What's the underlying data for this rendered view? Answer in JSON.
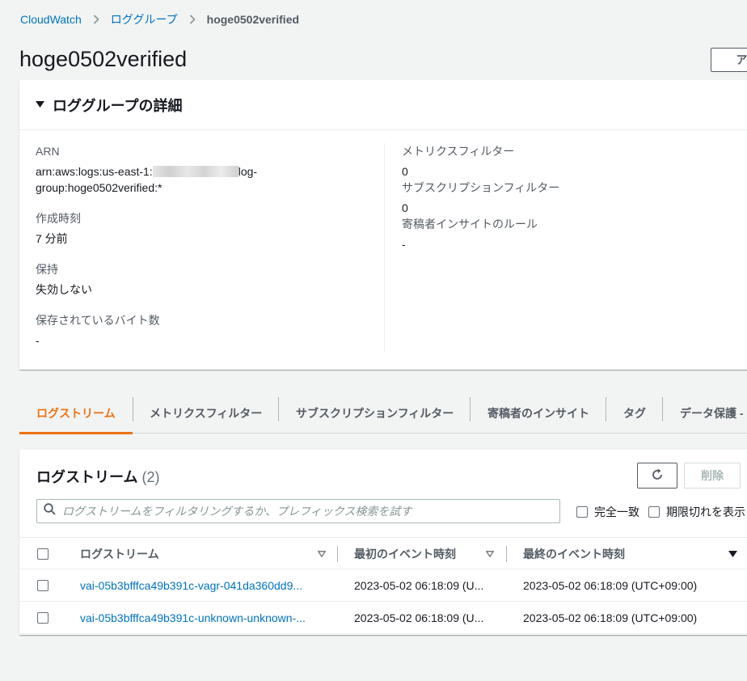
{
  "breadcrumb": {
    "items": [
      "CloudWatch",
      "ロググループ"
    ],
    "current": "hoge0502verified"
  },
  "page": {
    "title": "hoge0502verified",
    "actions_label": "アク"
  },
  "details": {
    "heading": "ロググループの詳細",
    "arn_label": "ARN",
    "arn_prefix": "arn:aws:logs:us-east-1:",
    "arn_suffix": "log-",
    "arn_line2": "group:hoge0502verified:*",
    "created_label": "作成時刻",
    "created_value": "7 分前",
    "retention_label": "保持",
    "retention_value": "失効しない",
    "stored_bytes_label": "保存されているバイト数",
    "stored_bytes_value": "-",
    "metric_filters_label": "メトリクスフィルター",
    "metric_filters_value": "0",
    "subscription_filters_label": "サブスクリプションフィルター",
    "subscription_filters_value": "0",
    "contributor_rules_label": "寄稿者インサイトのルール",
    "contributor_rules_value": "-"
  },
  "tabs": [
    "ログストリーム",
    "メトリクスフィルター",
    "サブスクリプションフィルター",
    "寄稿者のインサイト",
    "タグ",
    "データ保護 -"
  ],
  "streams": {
    "title": "ログストリーム",
    "count": "(2)",
    "delete_label": "削除",
    "search_placeholder": "ログストリームをフィルタリングするか、プレフィックス検索を試す",
    "exact_match_label": "完全一致",
    "show_expired_label": "期限切れを表示",
    "columns": [
      "ログストリーム",
      "最初のイベント時刻",
      "最終のイベント時刻"
    ],
    "rows": [
      {
        "name": "vai-05b3bfffca49b391c-vagr-041da360dd9...",
        "first_event": "2023-05-02 06:18:09 (U...",
        "last_event": "2023-05-02 06:18:09 (UTC+09:00)"
      },
      {
        "name": "vai-05b3bfffca49b391c-unknown-unknown-...",
        "first_event": "2023-05-02 06:18:09 (U...",
        "last_event": "2023-05-02 06:18:09 (UTC+09:00)"
      }
    ]
  }
}
